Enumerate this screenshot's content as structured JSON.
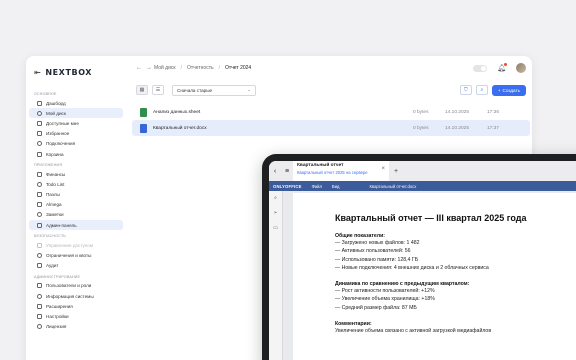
{
  "app": {
    "logo": "NEXTBOX"
  },
  "sidebar": {
    "sections": [
      {
        "title": "ОСНОВНОЕ",
        "items": [
          {
            "label": "Дашборд"
          },
          {
            "label": "Мой диск",
            "active": true
          },
          {
            "label": "Доступные мне"
          },
          {
            "label": "Избранное"
          },
          {
            "label": "Подключения"
          },
          {
            "label": "Корзина"
          }
        ]
      },
      {
        "title": "ПРИЛОЖЕНИЯ",
        "items": [
          {
            "label": "Финансы"
          },
          {
            "label": "Todo List"
          },
          {
            "label": "Пазлы"
          },
          {
            "label": "Almega"
          },
          {
            "label": "Заметки"
          },
          {
            "label": "Админ-панель",
            "active": true
          }
        ]
      },
      {
        "title": "БЕЗОПАСНОСТЬ",
        "items": [
          {
            "label": "Управление доступом",
            "disabled": true
          },
          {
            "label": "Ограничения и квоты"
          },
          {
            "label": "Аудит"
          }
        ]
      },
      {
        "title": "АДМИНИСТРИРОВАНИЕ",
        "items": [
          {
            "label": "Пользователи и роли"
          },
          {
            "label": "Информация системы"
          },
          {
            "label": "Расширения"
          },
          {
            "label": "Настройки"
          },
          {
            "label": "Лицензия"
          }
        ]
      }
    ]
  },
  "header": {
    "breadcrumbs": [
      "Мой диск",
      "Отчетность",
      "Отчет 2024"
    ]
  },
  "toolbar": {
    "sort_value": "Сначала старые",
    "create_label": "Создать"
  },
  "files": [
    {
      "name": "Анализ данных.sheet",
      "type": "sheet",
      "size": "0 bytes",
      "date": "14.10.2025",
      "time": "17:36"
    },
    {
      "name": "Квартальный отчет.docx",
      "type": "doc",
      "size": "0 bytes",
      "date": "14.10.2025",
      "time": "17:37",
      "selected": true
    }
  ],
  "tablet": {
    "tab_title": "Квартальный отчет",
    "tab_subtitle": "Квартальный отчет 2025 на сервере",
    "oo_brand": "ONLYOFFICE",
    "oo_menu": [
      "Файл",
      "Вид"
    ],
    "oo_filename": "Квартальный отчет.docx",
    "doc": {
      "title": "Квартальный отчет — III квартал 2025 года",
      "section1_title": "Общие показатели:",
      "section1_lines": [
        "— Загружено новых файлов: 1 482",
        "— Активных пользователей: 56",
        "— Использовано памяти: 128,4 ГБ",
        "— Новые подключения: 4 внешних диска и 2 облачных сервиса"
      ],
      "section2_title": "Динамика по сравнению с предыдущим кварталом:",
      "section2_lines": [
        "— Рост активности пользователей: +12%",
        "— Увеличение объема хранилища: +18%",
        "— Средний размер файла: 87 МБ"
      ],
      "section3_title": "Комментарии:",
      "section3_lines": [
        "Увеличение объема связано с активной загрузкой медиафайлов"
      ]
    }
  }
}
